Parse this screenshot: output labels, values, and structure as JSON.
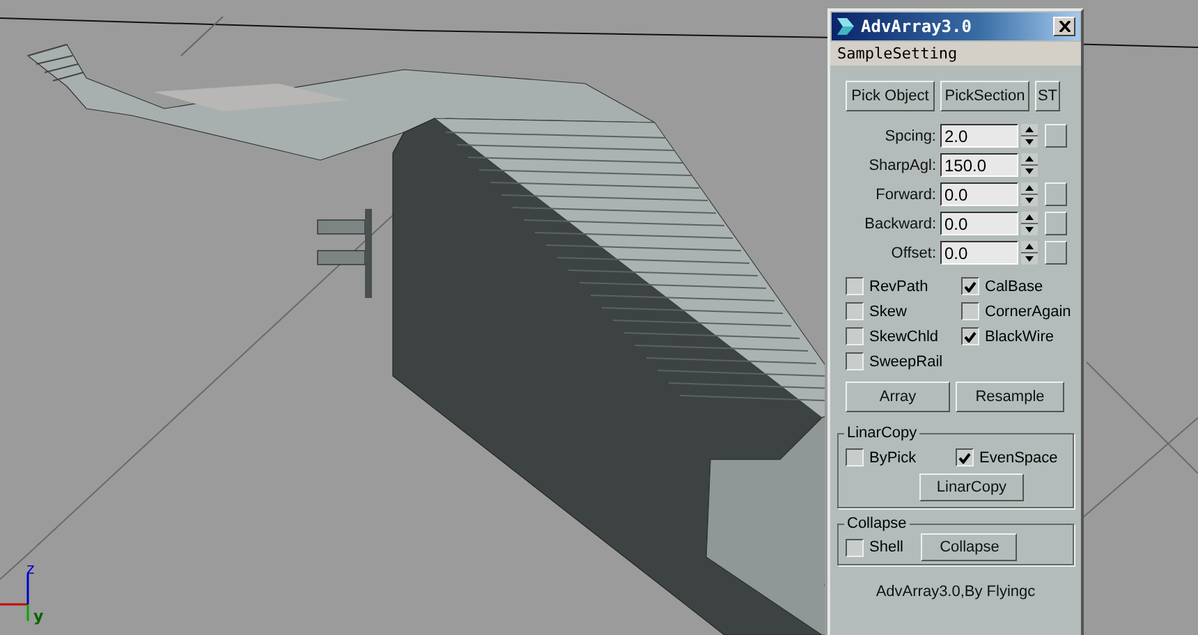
{
  "viewport": {
    "axis_labels": [
      "z",
      "y"
    ]
  },
  "window": {
    "title": "AdvArray3.0"
  },
  "menu": [
    "SampleSetting"
  ],
  "pick_buttons": [
    "Pick Object",
    "PickSection",
    "ST"
  ],
  "fields": [
    {
      "label": "Spcing:",
      "value": "2.0",
      "has_button": true
    },
    {
      "label": "SharpAgl:",
      "value": "150.0",
      "has_button": false
    },
    {
      "label": "Forward:",
      "value": "0.0",
      "has_button": true
    },
    {
      "label": "Backward:",
      "value": "0.0",
      "has_button": true
    },
    {
      "label": "Offset:",
      "value": "0.0",
      "has_button": true
    }
  ],
  "checkboxes": [
    {
      "label": "RevPath",
      "checked": false
    },
    {
      "label": "CalBase",
      "checked": true
    },
    {
      "label": "Skew",
      "checked": false
    },
    {
      "label": "CornerAgain",
      "checked": false
    },
    {
      "label": "SkewChld",
      "checked": false
    },
    {
      "label": "BlackWire",
      "checked": true
    },
    {
      "label": "SweepRail",
      "checked": false
    }
  ],
  "action_buttons": [
    "Array",
    "Resample"
  ],
  "linar_copy": {
    "title": "LinarCopy",
    "checkboxes": [
      {
        "label": "ByPick",
        "checked": false
      },
      {
        "label": "EvenSpace",
        "checked": true
      }
    ],
    "button": "LinarCopy"
  },
  "collapse": {
    "title": "Collapse",
    "checkbox": {
      "label": "Shell",
      "checked": false
    },
    "button": "Collapse"
  },
  "footer": "AdvArray3.0,By Flyingc"
}
